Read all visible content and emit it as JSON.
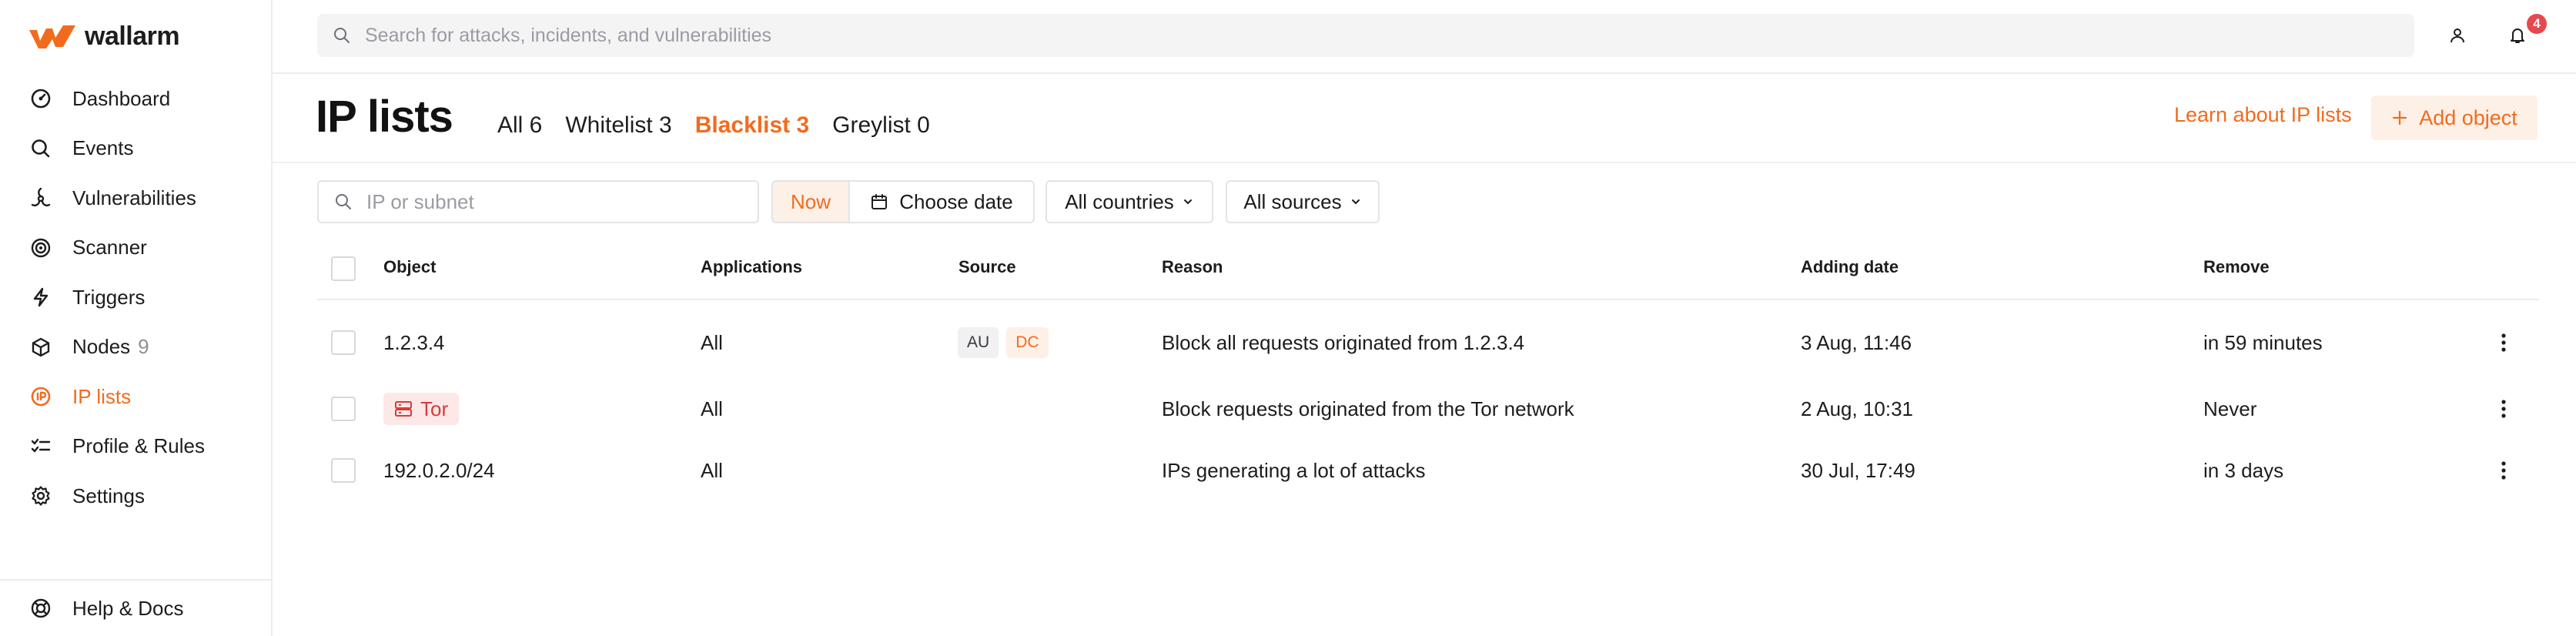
{
  "brand": {
    "name": "wallarm",
    "color": "#f26b1d"
  },
  "sidebar": {
    "items": [
      {
        "label": "Dashboard",
        "icon": "dashboard-icon"
      },
      {
        "label": "Events",
        "icon": "search-icon"
      },
      {
        "label": "Vulnerabilities",
        "icon": "biohazard-icon"
      },
      {
        "label": "Scanner",
        "icon": "radar-icon"
      },
      {
        "label": "Triggers",
        "icon": "lightning-icon"
      },
      {
        "label": "Nodes",
        "count": "9",
        "icon": "nodes-icon"
      },
      {
        "label": "IP lists",
        "icon": "ip-icon",
        "active": true
      },
      {
        "label": "Profile & Rules",
        "icon": "rules-icon"
      },
      {
        "label": "Settings",
        "icon": "gear-icon"
      }
    ],
    "footer": {
      "label": "Help & Docs",
      "icon": "lifebuoy-icon"
    }
  },
  "header": {
    "search_placeholder": "Search for attacks, incidents, and vulnerabilities",
    "notification_count": "4"
  },
  "page": {
    "title": "IP lists",
    "tabs": [
      {
        "label": "All 6"
      },
      {
        "label": "Whitelist 3"
      },
      {
        "label": "Blacklist 3",
        "active": true
      },
      {
        "label": "Greylist 0"
      }
    ],
    "learn_link": "Learn about IP lists",
    "add_button": "Add object"
  },
  "filters": {
    "ip_placeholder": "IP or subnet",
    "now_label": "Now",
    "date_label": "Choose date",
    "countries_label": "All countries",
    "sources_label": "All sources"
  },
  "table": {
    "columns": [
      "Object",
      "Applications",
      "Source",
      "Reason",
      "Adding date",
      "Remove"
    ],
    "rows": [
      {
        "object": "1.2.3.4",
        "applications": "All",
        "sources": [
          "AU",
          "DC"
        ],
        "reason": "Block all requests originated from 1.2.3.4",
        "date": "3 Aug, 11:46",
        "remove": "in 59 minutes"
      },
      {
        "object": "Tor",
        "object_is_tag": true,
        "applications": "All",
        "sources": [],
        "reason": "Block requests originated from the Tor network",
        "date": "2 Aug, 10:31",
        "remove": "Never"
      },
      {
        "object": "192.0.2.0/24",
        "applications": "All",
        "sources": [],
        "reason": "IPs generating a lot of attacks",
        "date": "30 Jul, 17:49",
        "remove": "in 3 days"
      }
    ]
  }
}
